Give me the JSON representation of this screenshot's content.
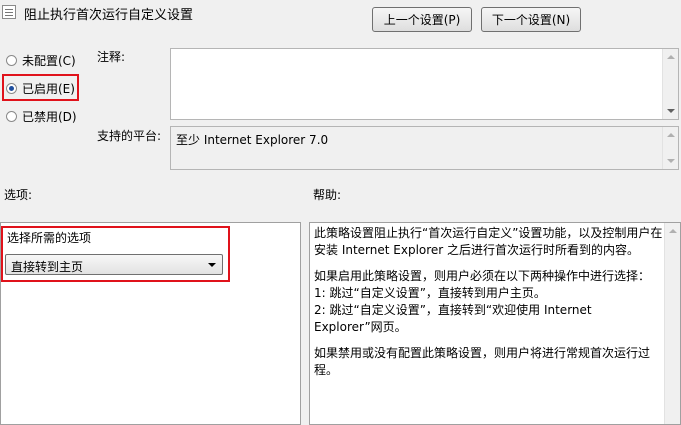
{
  "window": {
    "title": "阻止执行首次运行自定义设置",
    "prev_button": "上一个设置(P)",
    "next_button": "下一个设置(N)",
    "title_icon": "policy-icon"
  },
  "state": {
    "options": [
      {
        "label": "未配置(C)",
        "selected": false
      },
      {
        "label": "已启用(E)",
        "selected": true
      },
      {
        "label": "已禁用(D)",
        "selected": false
      }
    ],
    "highlight_color": "#e0121b"
  },
  "comment": {
    "label": "注释:",
    "value": ""
  },
  "platform": {
    "label": "支持的平台:",
    "value": "至少 Internet Explorer 7.0"
  },
  "options_section": {
    "label": "选项:",
    "select_label": "选择所需的选项",
    "select_value": "直接转到主页"
  },
  "help_section": {
    "label": "帮助:",
    "paragraphs": [
      "此策略设置阻止执行“首次运行自定义”设置功能，以及控制用户在安装 Internet Explorer 之后进行首次运行时所看到的内容。",
      "如果启用此策略设置，则用户必须在以下两种操作中进行选择：\n1: 跳过“自定义设置”，直接转到用户主页。\n2: 跳过“自定义设置”，直接转到“欢迎使用 Internet Explorer”网页。",
      "如果禁用或没有配置此策略设置，则用户将进行常规首次运行过程。"
    ]
  }
}
